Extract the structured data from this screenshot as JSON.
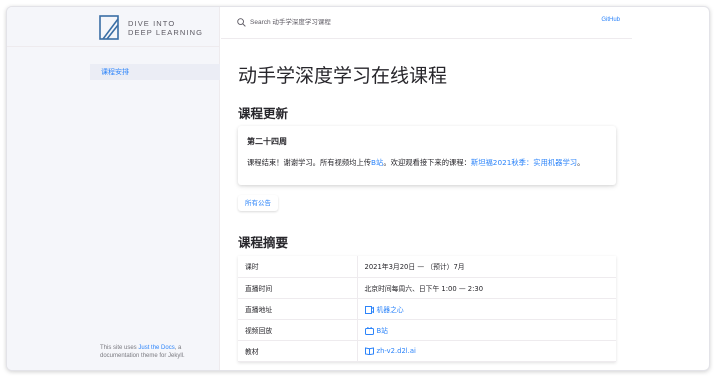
{
  "colors": {
    "accent": "#2c84fa",
    "text": "#27262b",
    "sidebar_bg": "#f5f6fa"
  },
  "logo": {
    "line1": "DIVE INTO",
    "line2": "DEEP LEARNING",
    "icon": "book-logo-icon"
  },
  "sidebar": {
    "items": [
      {
        "label": "课程安排",
        "active": true
      }
    ],
    "footer_prefix": "This site uses ",
    "footer_link": "Just the Docs",
    "footer_suffix": ", a documentation theme for Jekyll."
  },
  "topbar": {
    "search_placeholder": "Search 动手学深度学习课程",
    "search_icon": "search-icon",
    "github_label": "GitHub"
  },
  "main": {
    "title": "动手学深度学习在线课程",
    "updates_heading": "课程更新",
    "update_card": {
      "title": "第二十四周",
      "body_prefix": "课程结束！谢谢学习。所有视频均上传",
      "link1": "B站",
      "body_middle": "。欢迎观看接下来的课程：",
      "link2": "斯坦福2021秋季：实用机器学习",
      "body_suffix": "。"
    },
    "all_announcements_button": "所有公告",
    "summary_heading": "课程摘要",
    "summary_rows": [
      {
        "label": "课时",
        "value": "2021年3月20日 — （预计）7月",
        "link": false
      },
      {
        "label": "直播时间",
        "value": "北京时间每周六、日下午 1:00 — 2:30",
        "link": false
      },
      {
        "label": "直播地址",
        "value": "机器之心",
        "link": true,
        "icon": "live-stream-icon"
      },
      {
        "label": "视频回放",
        "value": "B站",
        "link": true,
        "icon": "bilibili-tv-icon"
      },
      {
        "label": "教材",
        "value": "zh-v2.d2l.ai",
        "link": true,
        "icon": "book-icon"
      }
    ]
  }
}
